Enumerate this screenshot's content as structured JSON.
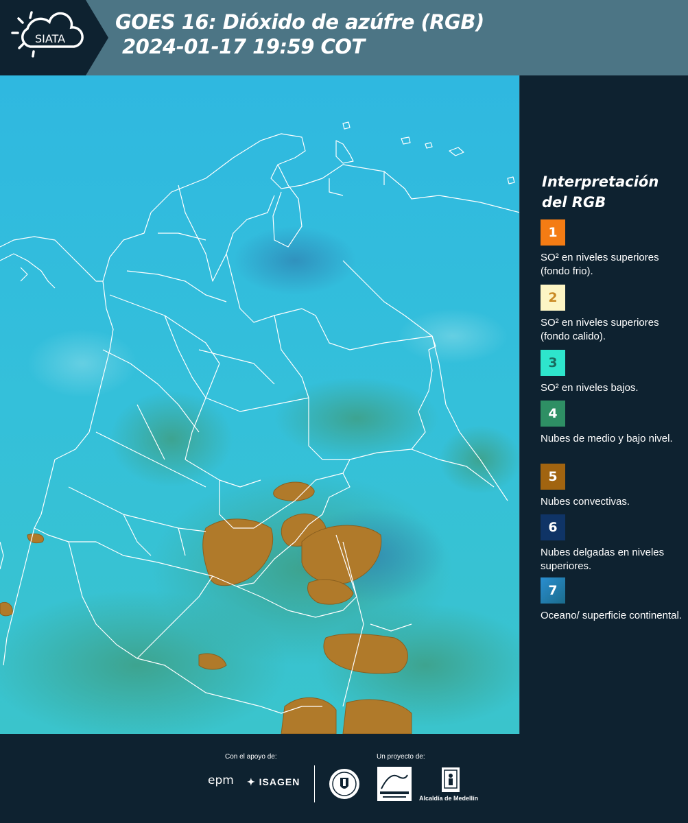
{
  "header": {
    "logo_text": "SIATA",
    "title_line1": "GOES 16: Dióxido de azúfre (RGB)",
    "title_line2": "2024-01-17 19:59 COT"
  },
  "map": {
    "background_color": "#2fb8d8",
    "border_color": "#ffffff"
  },
  "legend": {
    "title": "Interpretación del RGB",
    "items": [
      {
        "number": "1",
        "color": "#f47c14",
        "text": "SO² en niveles superiores (fondo frio)."
      },
      {
        "number": "2",
        "color": "#fdf5c4",
        "text": "SO² en niveles superiores (fondo calido)."
      },
      {
        "number": "3",
        "color": "#2ee5cc",
        "text": "SO² en niveles bajos."
      },
      {
        "number": "4",
        "color": "#2e8f64",
        "text": "Nubes de medio y bajo nivel."
      },
      {
        "number": "5",
        "color": "#a16410",
        "text": "Nubes convectivas."
      },
      {
        "number": "6",
        "color": "#0f3466",
        "text": "Nubes delgadas en niveles superiores."
      },
      {
        "number": "7",
        "color": "#2a8ed0",
        "text": "Oceano/ superficie continental."
      }
    ]
  },
  "footer": {
    "support_label": "Con el apoyo de:",
    "project_label": "Un proyecto de:",
    "sponsors": [
      "epm",
      "ISAGEN"
    ],
    "partners": [
      "Área Metropolitana Valle de Aburrá",
      "Alcaldía de Medellín"
    ]
  }
}
